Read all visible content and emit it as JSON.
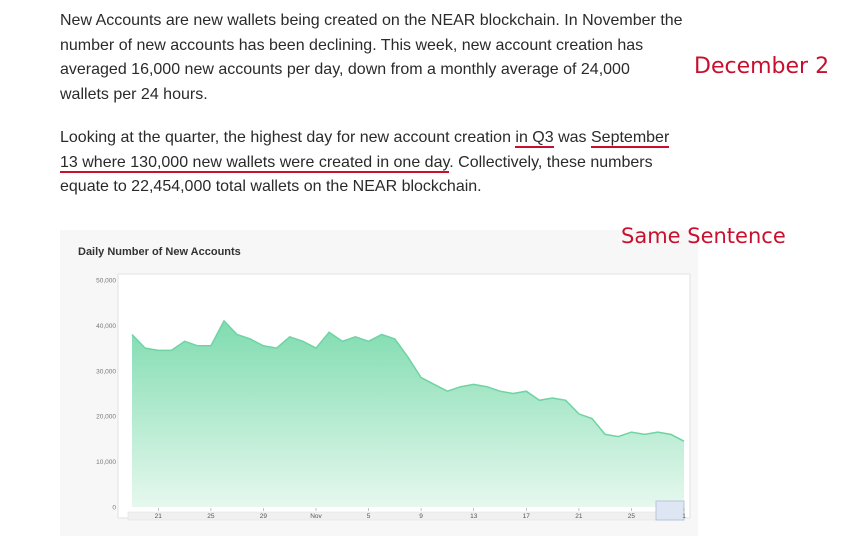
{
  "paragraph1": {
    "lines": [
      "New Accounts are new wallets being created on the NEAR blockchain. In November the",
      "number of new accounts has been declining. This week, new account creation has",
      "averaged 16,000 new accounts per day, down from a monthly average of 24,000",
      "wallets per 24 hours."
    ]
  },
  "paragraph2": {
    "line1": {
      "a": "Looking at the quarter, the highest day for new account creation ",
      "b": "in Q3",
      "c": " was ",
      "d": "September"
    },
    "line2": {
      "a": "13 where 130,000 new wallets were created in one day",
      "b": ". Collectively, these numbers"
    },
    "line3": "equate to 22,454,000 total wallets on the NEAR blockchain."
  },
  "annotations": {
    "date": "December 2",
    "same_sentence": "Same Sentence"
  },
  "colors": {
    "annotation": "#c8102e",
    "area_fill_top": "#7fdcb0",
    "area_fill_bottom": "#e6f8ee",
    "area_line": "#6fd3a4"
  },
  "chart_data": {
    "type": "area",
    "title": "Daily Number of New Accounts",
    "ylim": [
      0,
      50000
    ],
    "yticks": [
      0,
      10000,
      20000,
      30000,
      40000,
      50000
    ],
    "ytick_labels": [
      "0",
      "10,000",
      "20,000",
      "30,000",
      "40,000",
      "50,000"
    ],
    "xtick_labels": [
      "21",
      "25",
      "29",
      "Nov",
      "5",
      "9",
      "13",
      "17",
      "21",
      "25",
      "1"
    ],
    "xlim": [
      0,
      42
    ],
    "xtick_positions": [
      2,
      6,
      10,
      14,
      18,
      22,
      26,
      30,
      34,
      38,
      42
    ],
    "x": [
      0,
      1,
      2,
      3,
      4,
      5,
      6,
      7,
      8,
      9,
      10,
      11,
      12,
      13,
      14,
      15,
      16,
      17,
      18,
      19,
      20,
      21,
      22,
      23,
      24,
      25,
      26,
      27,
      28,
      29,
      30,
      31,
      32,
      33,
      34,
      35,
      36,
      37,
      38,
      39,
      40,
      41,
      42
    ],
    "values": [
      38000,
      35000,
      34500,
      34500,
      36500,
      35500,
      35500,
      41000,
      38000,
      37000,
      35500,
      35000,
      37500,
      36500,
      35000,
      38500,
      36500,
      37500,
      36500,
      38000,
      37000,
      33000,
      28500,
      27000,
      25500,
      26500,
      27000,
      26500,
      25500,
      25000,
      25500,
      23500,
      24000,
      23500,
      20500,
      19500,
      16000,
      15500,
      16500,
      16000,
      16500,
      16000,
      14500
    ],
    "grid": false,
    "legend": "none"
  }
}
